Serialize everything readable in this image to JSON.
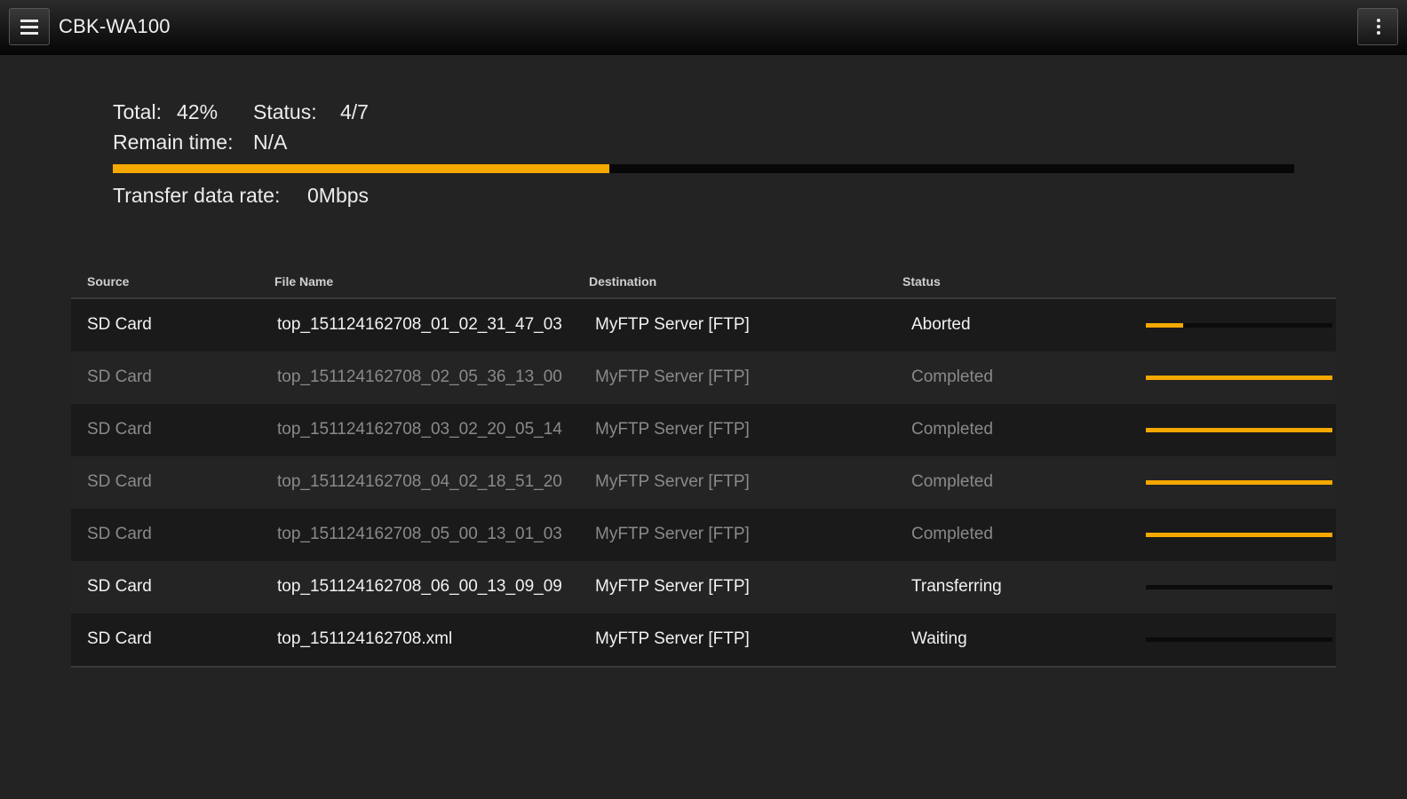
{
  "app": {
    "title": "CBK-WA100",
    "menu_icon": "hamburger-menu-icon",
    "more_icon": "overflow-menu-icon"
  },
  "summary": {
    "total_label": "Total:",
    "total_value": "42%",
    "total_progress": 0.42,
    "status_label": "Status:",
    "status_value": "4/7",
    "remain_label": "Remain time:",
    "remain_value": "N/A",
    "rate_label": "Transfer data rate:",
    "rate_value": "0Mbps"
  },
  "colors": {
    "accent": "#f5a800",
    "background": "#232323",
    "topbar": "#050505"
  },
  "table": {
    "headers": {
      "source": "Source",
      "file_name": "File Name",
      "destination": "Destination",
      "status": "Status"
    },
    "rows": [
      {
        "source": "SD Card",
        "file_name": "top_151124162708_01_02_31_47_03",
        "destination": "MyFTP Server [FTP]",
        "status": "Aborted",
        "progress": 0.2,
        "dim": false
      },
      {
        "source": "SD Card",
        "file_name": "top_151124162708_02_05_36_13_00",
        "destination": "MyFTP Server [FTP]",
        "status": "Completed",
        "progress": 1.0,
        "dim": true
      },
      {
        "source": "SD Card",
        "file_name": "top_151124162708_03_02_20_05_14",
        "destination": "MyFTP Server [FTP]",
        "status": "Completed",
        "progress": 1.0,
        "dim": true
      },
      {
        "source": "SD Card",
        "file_name": "top_151124162708_04_02_18_51_20",
        "destination": "MyFTP Server [FTP]",
        "status": "Completed",
        "progress": 1.0,
        "dim": true
      },
      {
        "source": "SD Card",
        "file_name": "top_151124162708_05_00_13_01_03",
        "destination": "MyFTP Server [FTP]",
        "status": "Completed",
        "progress": 1.0,
        "dim": true
      },
      {
        "source": "SD Card",
        "file_name": "top_151124162708_06_00_13_09_09",
        "destination": "MyFTP Server [FTP]",
        "status": "Transferring",
        "progress": 0.0,
        "dim": false
      },
      {
        "source": "SD Card",
        "file_name": "top_151124162708.xml",
        "destination": "MyFTP Server [FTP]",
        "status": "Waiting",
        "progress": 0.0,
        "dim": false
      }
    ]
  }
}
